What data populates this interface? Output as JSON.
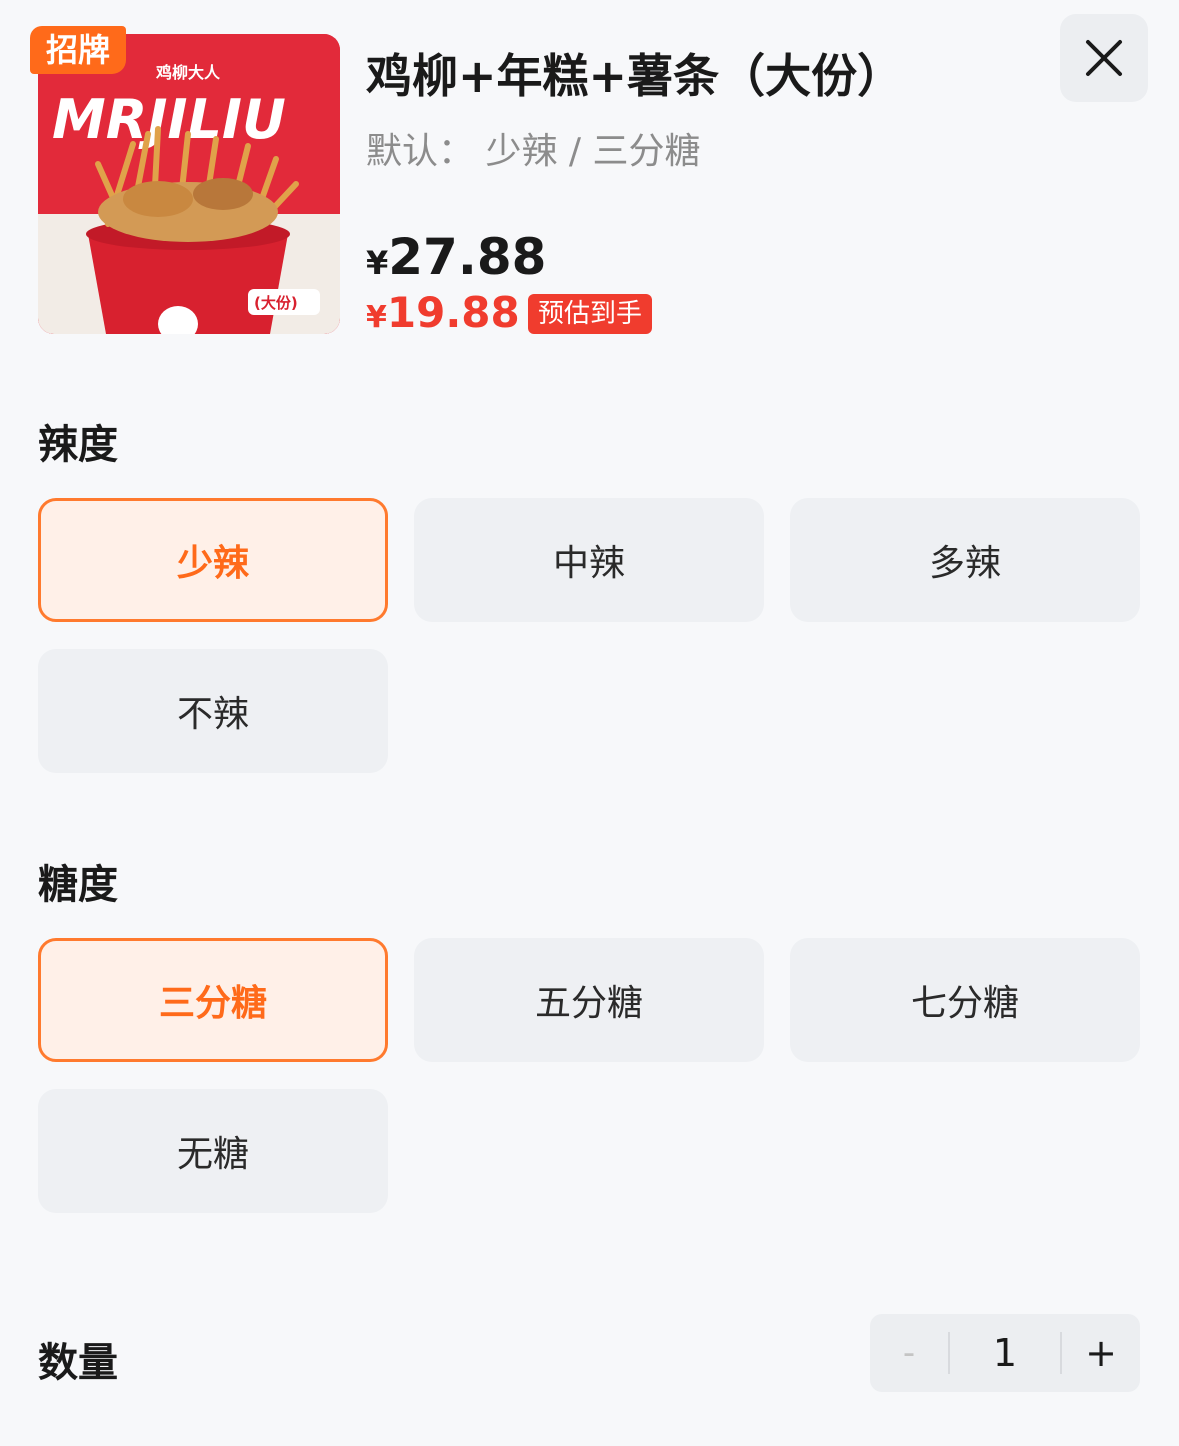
{
  "product": {
    "badge": "招牌",
    "image_brand_cn": "鸡柳大人",
    "image_brand_en": "MRJILIU",
    "image_size_tag": "(大份)",
    "title": "鸡柳+年糕+薯条（大份）",
    "default_spec": "默认： 少辣 / 三分糖",
    "price_original_symbol": "¥",
    "price_original": "27.88",
    "price_now_symbol": "¥",
    "price_now": "19.88",
    "price_tag": "预估到手"
  },
  "spicy": {
    "title": "辣度",
    "options": [
      "少辣",
      "中辣",
      "多辣",
      "不辣"
    ],
    "selected": "少辣"
  },
  "sugar": {
    "title": "糖度",
    "options": [
      "三分糖",
      "五分糖",
      "七分糖",
      "无糖"
    ],
    "selected": "三分糖"
  },
  "quantity": {
    "title": "数量",
    "minus": "-",
    "value": "1",
    "plus": "+"
  },
  "colors": {
    "accent": "#ff6a1a",
    "price_red": "#f03c2e",
    "image_red": "#e22a3a"
  }
}
